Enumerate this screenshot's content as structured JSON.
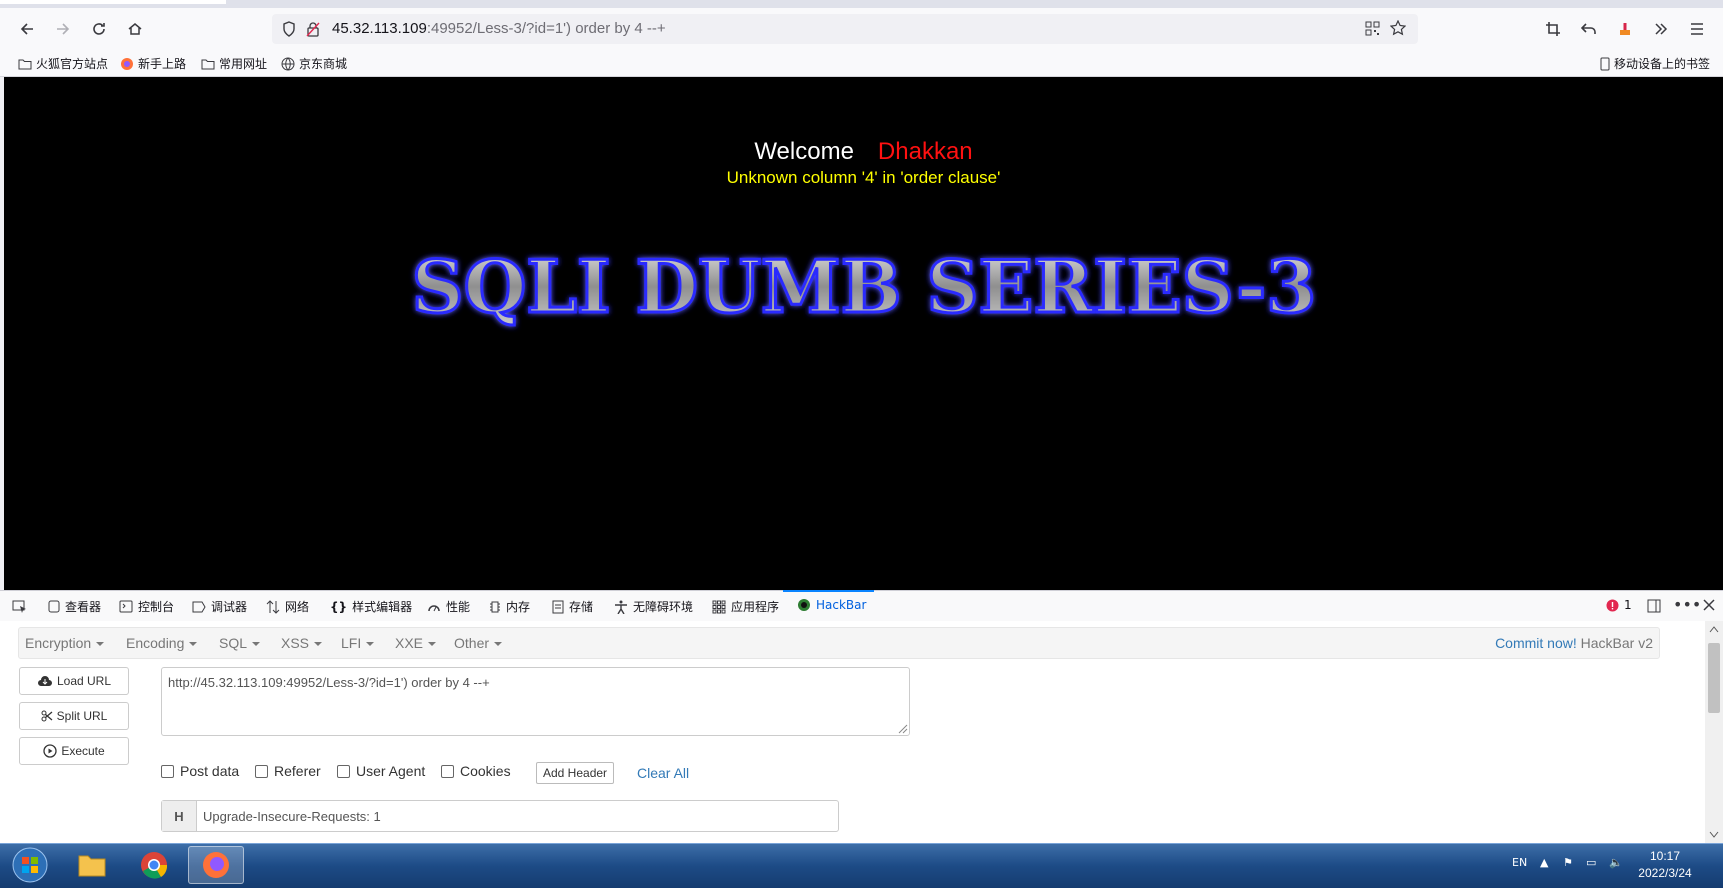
{
  "browser": {
    "url_host": "45.32.113.109",
    "url_rest": ":49952/Less-3/?id=1') order by 4 --+",
    "bookmarks": [
      "火狐官方站点",
      "新手上路",
      "常用网址",
      "京东商城"
    ],
    "mobile_bookmarks": "移动设备上的书签"
  },
  "page": {
    "welcome": "Welcome",
    "user": "Dhakkan",
    "error": "Unknown column '4' in 'order clause'",
    "banner": "SQLI DUMB SERIES-3"
  },
  "devtools": {
    "tabs": [
      "查看器",
      "控制台",
      "调试器",
      "网络",
      "样式编辑器",
      "性能",
      "内存",
      "存储",
      "无障碍环境",
      "应用程序",
      "HackBar"
    ],
    "error_count": "1"
  },
  "hackbar": {
    "menus": [
      "Encryption",
      "Encoding",
      "SQL",
      "XSS",
      "LFI",
      "XXE",
      "Other"
    ],
    "commit_link": "Commit now!",
    "version": "HackBar v2",
    "load_url": "Load URL",
    "split_url": "Split URL",
    "execute": "Execute",
    "url_value": "http://45.32.113.109:49952/Less-3/?id=1') order by 4 --+",
    "options": [
      "Post data",
      "Referer",
      "User Agent",
      "Cookies"
    ],
    "add_header": "Add Header",
    "clear_all": "Clear All",
    "header_tag": "H",
    "header_value": "Upgrade-Insecure-Requests: 1"
  },
  "taskbar": {
    "lang": "EN",
    "time": "10:17",
    "date": "2022/3/24"
  }
}
